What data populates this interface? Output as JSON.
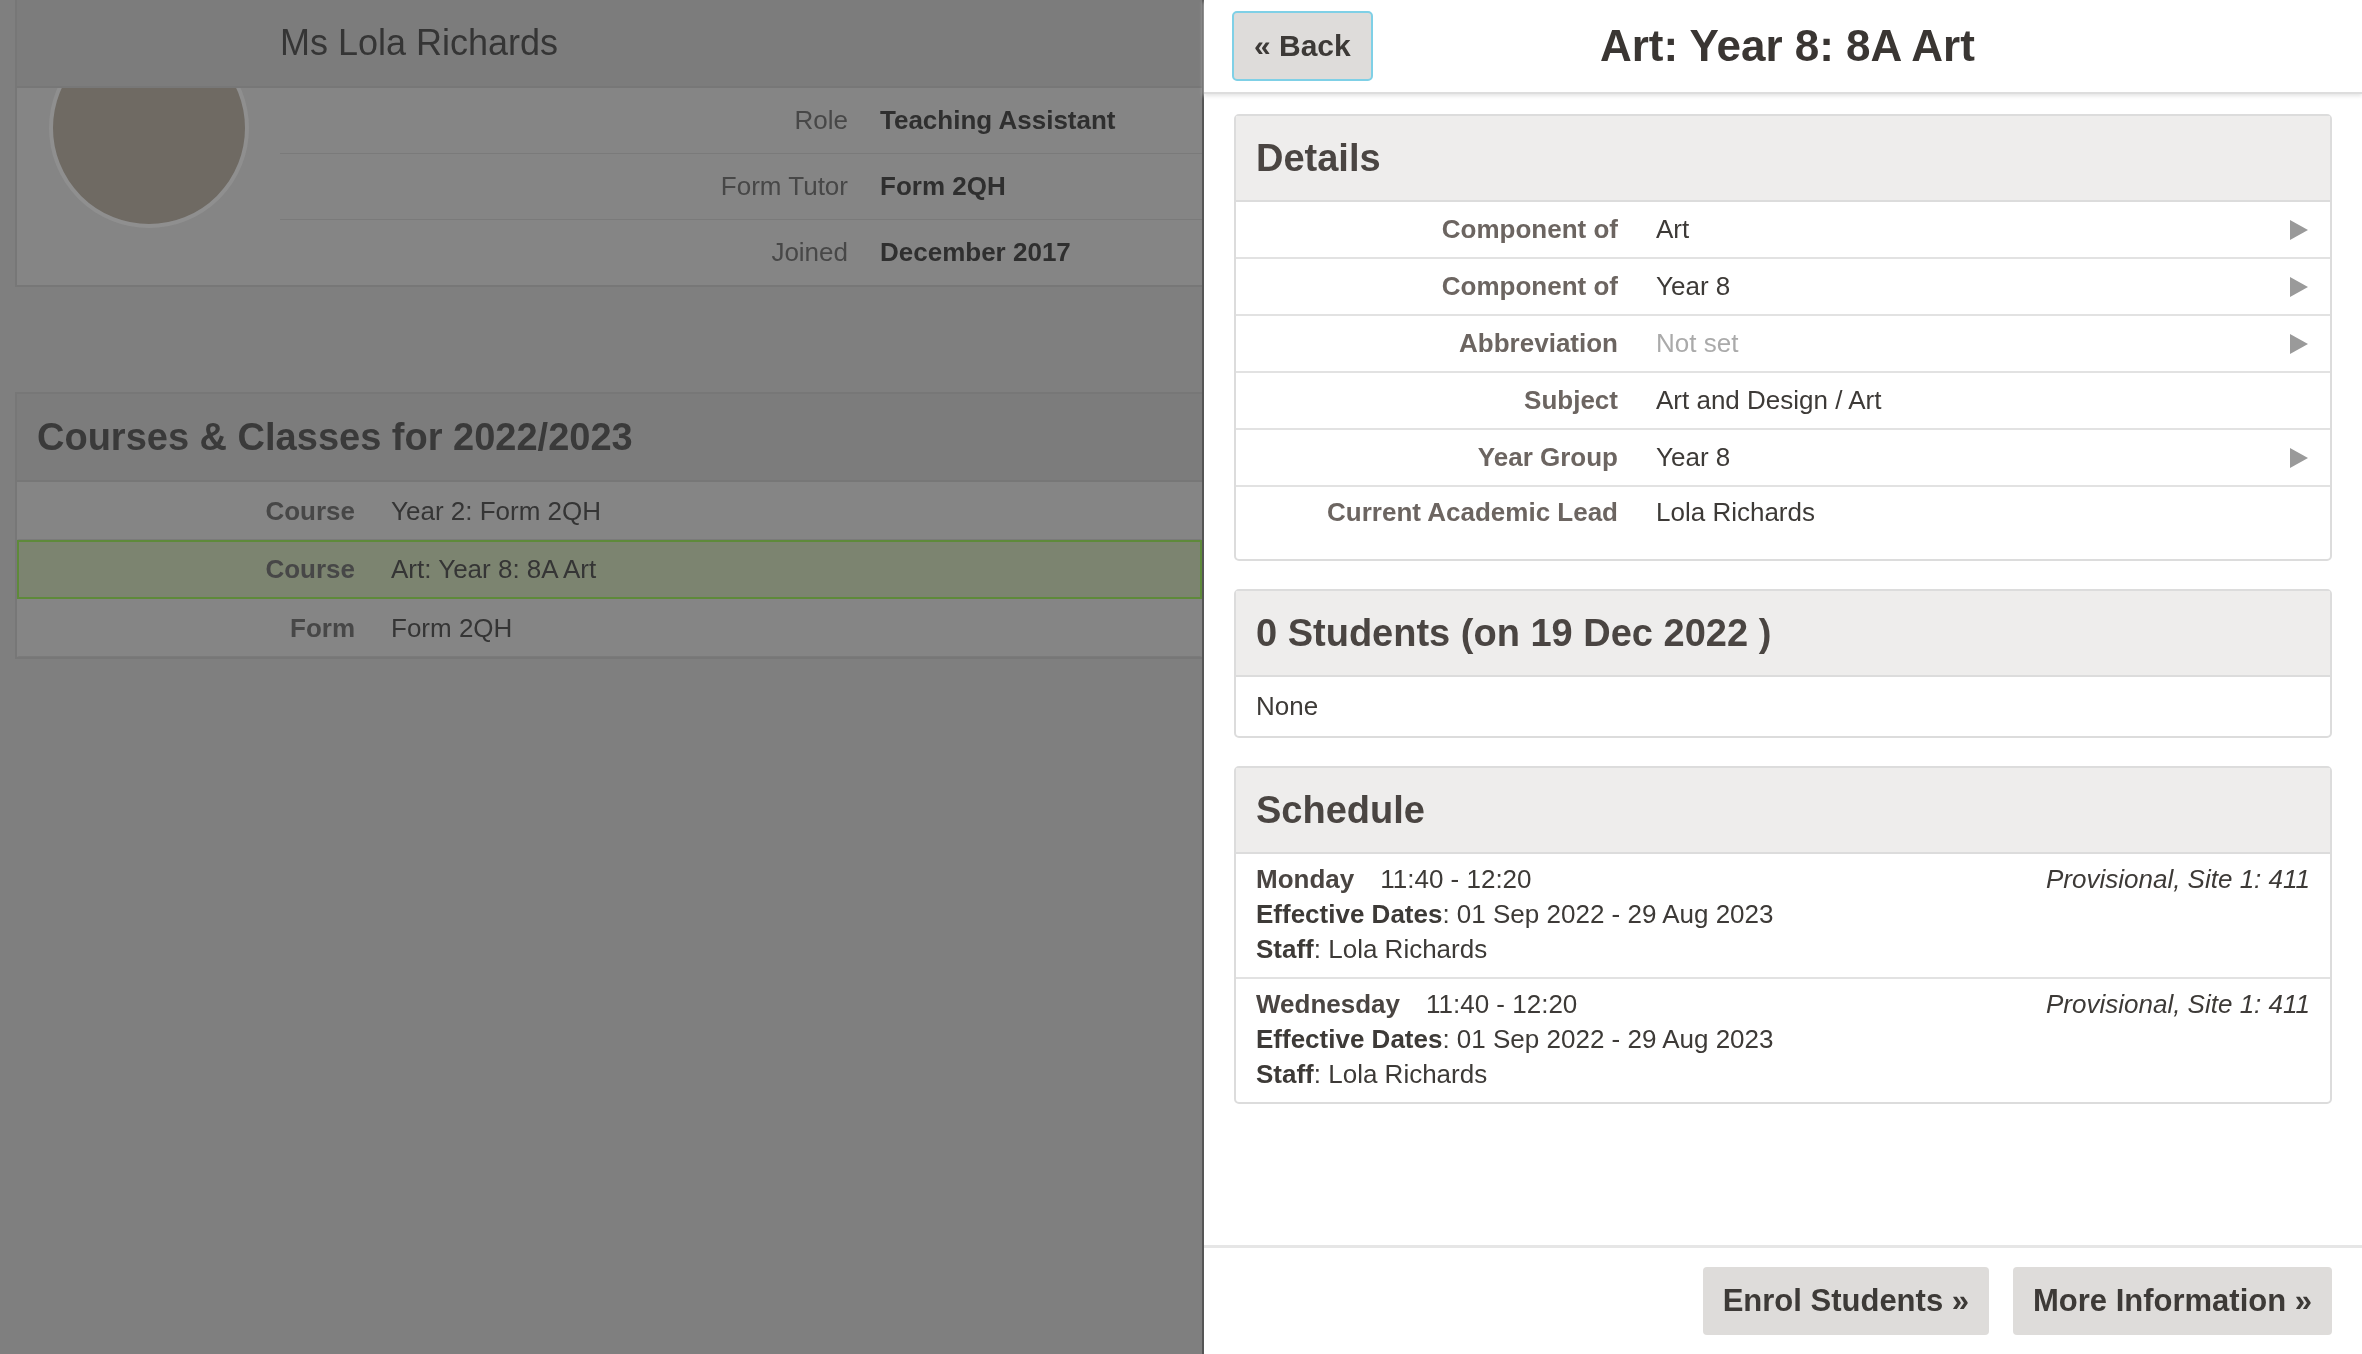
{
  "profile": {
    "name": "Ms Lola Richards",
    "fields": [
      {
        "label": "Role",
        "value": "Teaching Assistant"
      },
      {
        "label": "Form Tutor",
        "value": "Form 2QH"
      },
      {
        "label": "Joined",
        "value": "December 2017"
      }
    ]
  },
  "courses": {
    "title": "Courses & Classes for 2022/2023",
    "rows": [
      {
        "label": "Course",
        "value": "Year 2: Form 2QH",
        "selected": false
      },
      {
        "label": "Course",
        "value": "Art: Year 8: 8A Art",
        "selected": true
      },
      {
        "label": "Form",
        "value": "Form 2QH",
        "selected": false
      }
    ]
  },
  "panel": {
    "back": "« Back",
    "title": "Art: Year 8: 8A Art",
    "details": {
      "title": "Details",
      "rows": [
        {
          "label": "Component of",
          "value": "Art",
          "unset": false,
          "linked": true
        },
        {
          "label": "Component of",
          "value": "Year 8",
          "unset": false,
          "linked": true
        },
        {
          "label": "Abbreviation",
          "value": "Not set",
          "unset": true,
          "linked": true
        },
        {
          "label": "Subject",
          "value": "Art and Design / Art",
          "unset": false,
          "linked": false
        },
        {
          "label": "Year Group",
          "value": "Year 8",
          "unset": false,
          "linked": true
        },
        {
          "label": "Current Academic Lead",
          "value": "Lola Richards",
          "unset": false,
          "linked": false
        }
      ]
    },
    "students": {
      "title": "0 Students (on 19 Dec 2022 )",
      "empty": "None"
    },
    "schedule": {
      "title": "Schedule",
      "entries": [
        {
          "day": "Monday",
          "time": "11:40 - 12:20",
          "location": "Provisional, Site 1: 411",
          "dates": "**Effective Dates**: 01 Sep 2022 - 29 Aug 2023",
          "staff": "**Staff**: Lola Richards"
        },
        {
          "day": "Wednesday",
          "time": "11:40 - 12:20",
          "location": "Provisional, Site 1: 411",
          "dates": "**Effective Dates**: 01 Sep 2022 - 29 Aug 2023",
          "staff": "**Staff**: Lola Richards"
        }
      ]
    },
    "buttons": [
      "Enrol Students »",
      "More Information »"
    ]
  }
}
